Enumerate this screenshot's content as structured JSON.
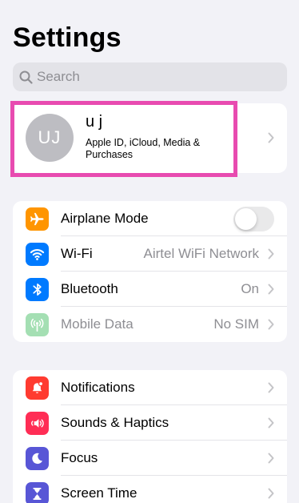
{
  "header": {
    "title": "Settings"
  },
  "search": {
    "placeholder": "Search"
  },
  "profile": {
    "initials": "UJ",
    "name": "u j",
    "subtitle": "Apple ID, iCloud, Media & Purchases",
    "highlight_color": "#e84bb0"
  },
  "group1": {
    "items": [
      {
        "label": "Airplane Mode",
        "icon": "airplane-icon",
        "icon_color": "#ff9500",
        "toggle": false
      },
      {
        "label": "Wi-Fi",
        "value": "Airtel WiFi Network",
        "icon": "wifi-icon",
        "icon_color": "#007aff"
      },
      {
        "label": "Bluetooth",
        "value": "On",
        "icon": "bluetooth-icon",
        "icon_color": "#007aff"
      },
      {
        "label": "Mobile Data",
        "value": "No SIM",
        "icon": "antenna-icon",
        "icon_color": "#a4dfb3",
        "disabled": true
      }
    ]
  },
  "group2": {
    "items": [
      {
        "label": "Notifications",
        "icon": "bell-icon",
        "icon_color": "#ff3b30"
      },
      {
        "label": "Sounds & Haptics",
        "icon": "speaker-icon",
        "icon_color": "#ff2d55"
      },
      {
        "label": "Focus",
        "icon": "moon-icon",
        "icon_color": "#5856d6"
      },
      {
        "label": "Screen Time",
        "icon": "hourglass-icon",
        "icon_color": "#5856d6"
      }
    ]
  }
}
